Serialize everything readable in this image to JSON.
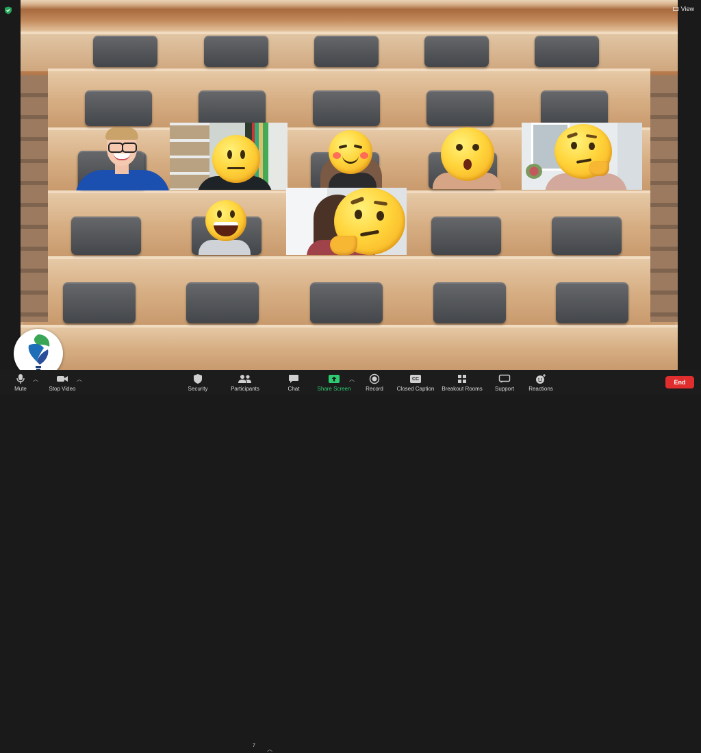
{
  "window": {
    "view_label": "View"
  },
  "meeting": {
    "host_name": ""
  },
  "toolbar": {
    "items": [
      {
        "label": "Mute",
        "icon": "microphone-icon"
      },
      {
        "label": "Stop Video",
        "icon": "video-camera-icon"
      },
      {
        "label": "Security",
        "icon": "shield-icon"
      },
      {
        "label": "Participants",
        "icon": "participants-icon",
        "count": "7"
      },
      {
        "label": "Chat",
        "icon": "chat-bubble-icon"
      },
      {
        "label": "Share Screen",
        "icon": "share-screen-icon"
      },
      {
        "label": "Record",
        "icon": "record-icon"
      },
      {
        "label": "Closed Caption",
        "icon": "closed-caption-icon",
        "badge": "CC"
      },
      {
        "label": "Breakout Rooms",
        "icon": "breakout-rooms-icon"
      },
      {
        "label": "Support",
        "icon": "support-icon"
      },
      {
        "label": "Reactions",
        "icon": "reactions-icon"
      }
    ],
    "end_label": "End"
  },
  "colors": {
    "toolbar_bg": "#1c1c1c",
    "share_green": "#2ecc71",
    "end_red": "#e02d2d",
    "security_badge_green": "#23a55a"
  },
  "participants": [
    {
      "face": "smiling-woman-photo"
    },
    {
      "face": "neutral-face-emoji"
    },
    {
      "face": "smiling-blushing-emoji"
    },
    {
      "face": "surprised-face-emoji"
    },
    {
      "face": "thinking-face-emoji"
    },
    {
      "face": "grinning-face-emoji"
    },
    {
      "face": "thinking-face-emoji"
    }
  ]
}
